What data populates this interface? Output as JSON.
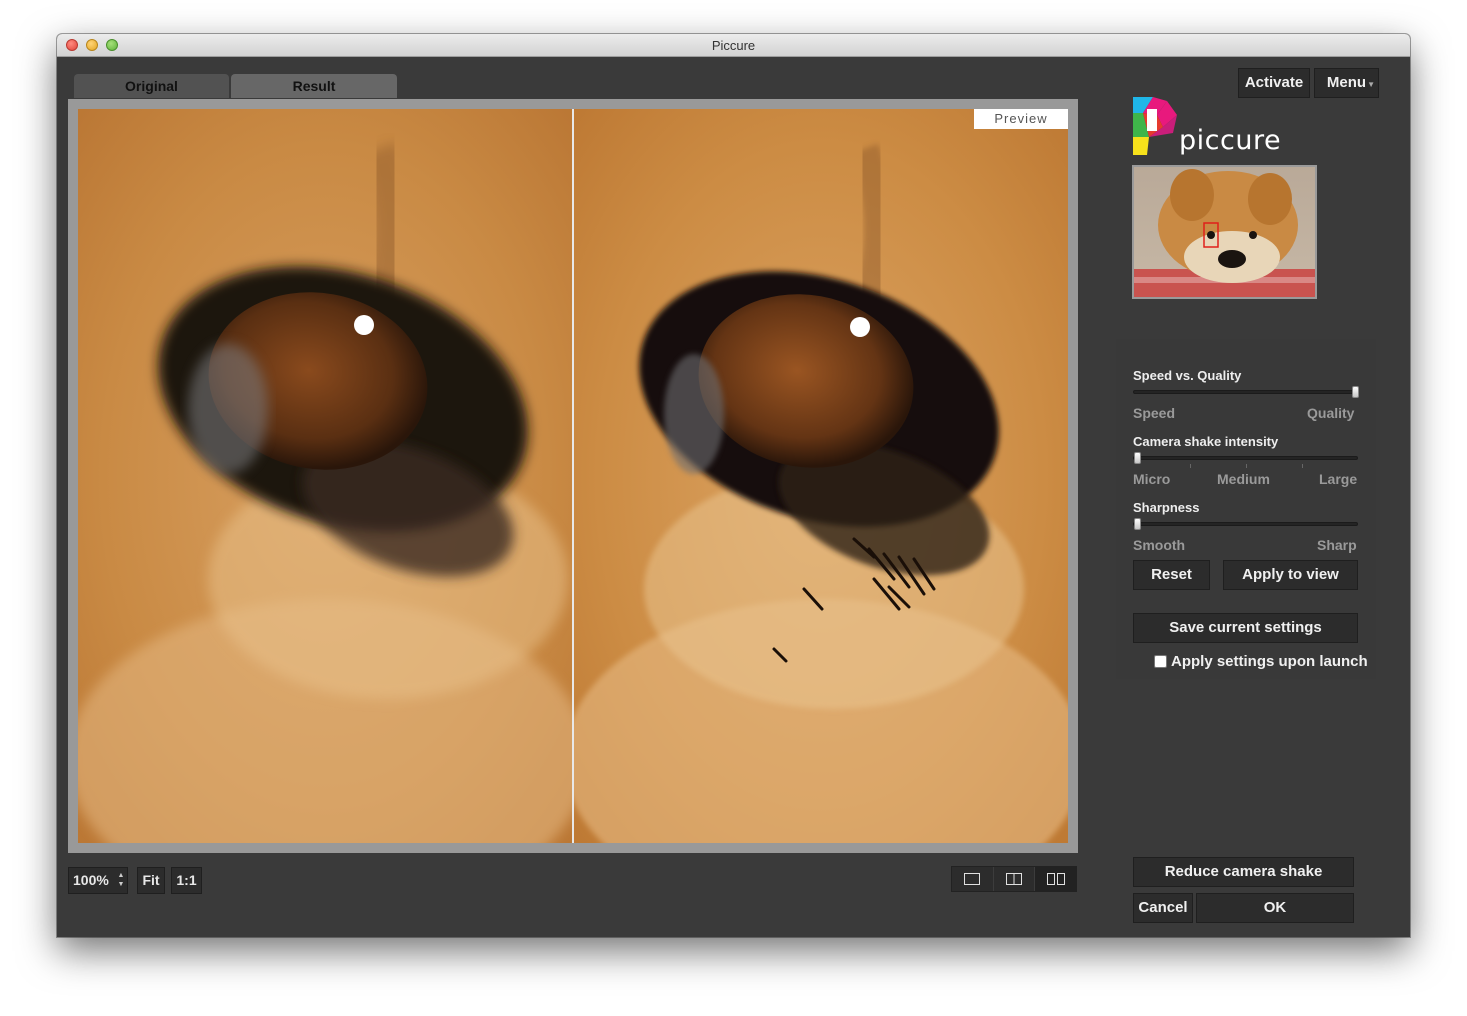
{
  "window": {
    "title": "Piccure"
  },
  "tabs": [
    {
      "label": "Original"
    },
    {
      "label": "Result"
    }
  ],
  "viewer": {
    "preview_label": "Preview"
  },
  "toolbar": {
    "zoom_value": "100%",
    "fit_label": "Fit",
    "one_to_one_label": "1:1",
    "view_modes": [
      "single-view-icon",
      "split-view-icon",
      "side-by-side-view-icon"
    ]
  },
  "header": {
    "activate_label": "Activate",
    "menu_label": "Menu",
    "logo_text": "piccure"
  },
  "settings": {
    "speed_quality": {
      "label": "Speed vs. Quality",
      "min_label": "Speed",
      "max_label": "Quality",
      "value": 1.0
    },
    "camera_shake": {
      "label": "Camera shake intensity",
      "labels": [
        "Micro",
        "Medium",
        "Large"
      ],
      "value": 0.0
    },
    "sharpness": {
      "label": "Sharpness",
      "min_label": "Smooth",
      "max_label": "Sharp",
      "value": 0.0
    },
    "reset_label": "Reset",
    "apply_label": "Apply to view",
    "save_label": "Save current settings",
    "launch_checkbox_label": "Apply settings upon launch",
    "launch_checked": false
  },
  "footer": {
    "reduce_label": "Reduce camera shake",
    "cancel_label": "Cancel",
    "ok_label": "OK"
  },
  "colors": {
    "window_bg": "#3a3a3a",
    "button_bg": "#2c2c2c",
    "viewer_border": "#999999",
    "logo_magenta": "#e8197d",
    "logo_yellow": "#f7e11b",
    "logo_cyan": "#1fb6e8",
    "logo_green": "#3fb54a",
    "logo_red": "#e63a2e"
  }
}
